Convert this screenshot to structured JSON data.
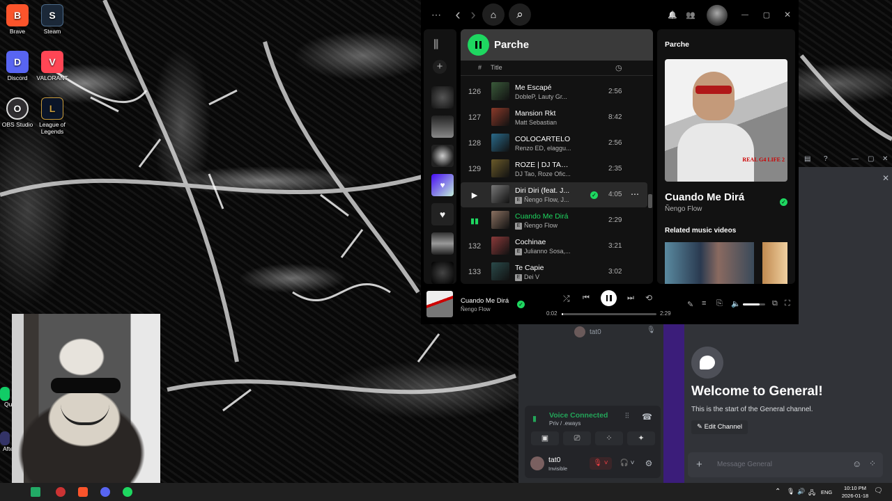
{
  "desktop": {
    "icons": [
      {
        "label": "Brave",
        "glyph": "B",
        "color": "#fb542b"
      },
      {
        "label": "Steam",
        "glyph": "S",
        "color": "#1b2838"
      },
      {
        "label": "Discord",
        "glyph": "D",
        "color": "#5865f2"
      },
      {
        "label": "VALORANT",
        "glyph": "V",
        "color": "#ff4655"
      },
      {
        "label": "OBS Studio",
        "glyph": "O",
        "color": "#302e31"
      },
      {
        "label": "League of Legends",
        "glyph": "L",
        "color": "#c89b3c"
      }
    ],
    "partial_labels": [
      "Qu",
      "Afte"
    ]
  },
  "spotify": {
    "topbar": {
      "more": "⋯",
      "back": "‹",
      "forward": "›",
      "home": "⌂",
      "search": "⌕",
      "bell": "🔔",
      "friends": "👥",
      "minimize": "—",
      "maximize": "▢",
      "close": "✕"
    },
    "library": {
      "library_icon": "⫼",
      "add": "+"
    },
    "playlist": {
      "name": "Parche"
    },
    "columns": {
      "num": "#",
      "title": "Title",
      "duration": "◷"
    },
    "tracks": [
      {
        "num": "126",
        "title": "Me Escapé",
        "artist": "DobleP, Lauty Gr...",
        "duration": "2:56",
        "explicit": false,
        "color": "#3a5a3a"
      },
      {
        "num": "127",
        "title": "Mansion Rkt",
        "artist": "Matt Sebastian",
        "duration": "8:42",
        "explicit": false,
        "color": "#8a3a2a"
      },
      {
        "num": "128",
        "title": "COLOCARTELO",
        "artist": "Renzo ED, elaggu...",
        "duration": "2:56",
        "explicit": false,
        "color": "#2a6a8a"
      },
      {
        "num": "129",
        "title": "ROZE | DJ TAO ...",
        "artist": "DJ Tao, Roze Ofic...",
        "duration": "2:35",
        "explicit": false,
        "color": "#6a5a2a"
      },
      {
        "num": "",
        "title": "Diri Diri (feat. J...",
        "artist": "Ñengo Flow, J...",
        "duration": "4:05",
        "explicit": true,
        "color": "#777777"
      },
      {
        "num": "",
        "title": "Cuando Me Dirá",
        "artist": "Ñengo Flow",
        "duration": "2:29",
        "explicit": true,
        "color": "#8a7060"
      },
      {
        "num": "132",
        "title": "Cochinae",
        "artist": "Julianno Sosa,...",
        "duration": "3:21",
        "explicit": true,
        "color": "#8a3a3a"
      },
      {
        "num": "133",
        "title": "Te Capie",
        "artist": "Dei V",
        "duration": "3:02",
        "explicit": true,
        "color": "#2a4a4a"
      }
    ],
    "now_playing_panel": {
      "header": "Parche",
      "song": "Cuando Me Dirá",
      "artist": "Ñengo Flow",
      "related_label": "Related music videos",
      "cover_text": "REAL G4 LIFE 2"
    },
    "player": {
      "song": "Cuando Me Dirá",
      "artist": "Ñengo Flow",
      "elapsed": "0:02",
      "total": "2:29",
      "progress": 0.013,
      "volume": 0.75
    },
    "colors": {
      "accent": "#1ed760",
      "bg": "#121212"
    }
  },
  "discord": {
    "member": "tat0",
    "voice_status": "Voice Connected",
    "voice_channel": "Priv / .eways",
    "user_name": "tat0",
    "user_status": "Invisible",
    "welcome_title": "Welcome to General!",
    "welcome_sub": "This is the start of the General channel.",
    "edit_channel": "Edit Channel",
    "message_placeholder": "Message General"
  },
  "taskbar": {
    "language": "ENG",
    "time": "10:10 PM",
    "date": "2026-01-18"
  }
}
